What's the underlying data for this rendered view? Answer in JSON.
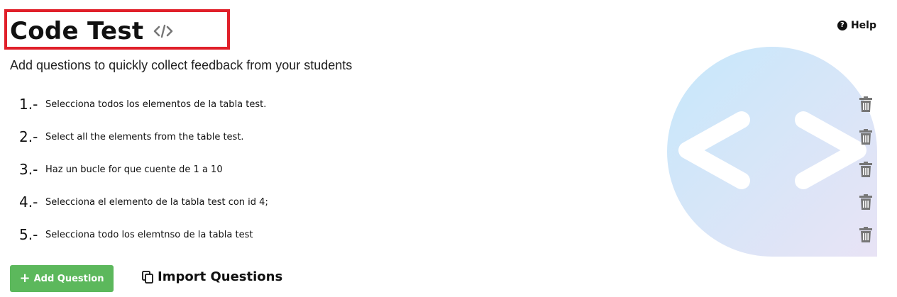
{
  "header": {
    "title": "Code Test",
    "title_icon": "code-icon",
    "help_label": "Help",
    "help_icon": "question-circle-icon",
    "subtitle": "Add questions to quickly collect feedback from your students"
  },
  "questions": [
    {
      "number": "1.-",
      "text": "Selecciona todos los elementos de la tabla test."
    },
    {
      "number": "2.-",
      "text": "Select all the elements from the table test."
    },
    {
      "number": "3.-",
      "text": "Haz un bucle for que cuente de 1 a 10"
    },
    {
      "number": "4.-",
      "text": "Selecciona el elemento de la tabla test con id 4;"
    },
    {
      "number": "5.-",
      "text": "Selecciona todo los elemtnso de la tabla test"
    }
  ],
  "actions": {
    "add_question_label": "Add Question",
    "add_icon": "plus-icon",
    "import_label": "Import Questions",
    "import_icon": "copy-icon",
    "delete_icon": "trash-icon"
  },
  "colors": {
    "highlight_border": "#e0202a",
    "add_button": "#5cb85c",
    "trash": "#777777",
    "logo_gradient_start": "#c9e9fa",
    "logo_gradient_end": "#e6e3f5"
  }
}
